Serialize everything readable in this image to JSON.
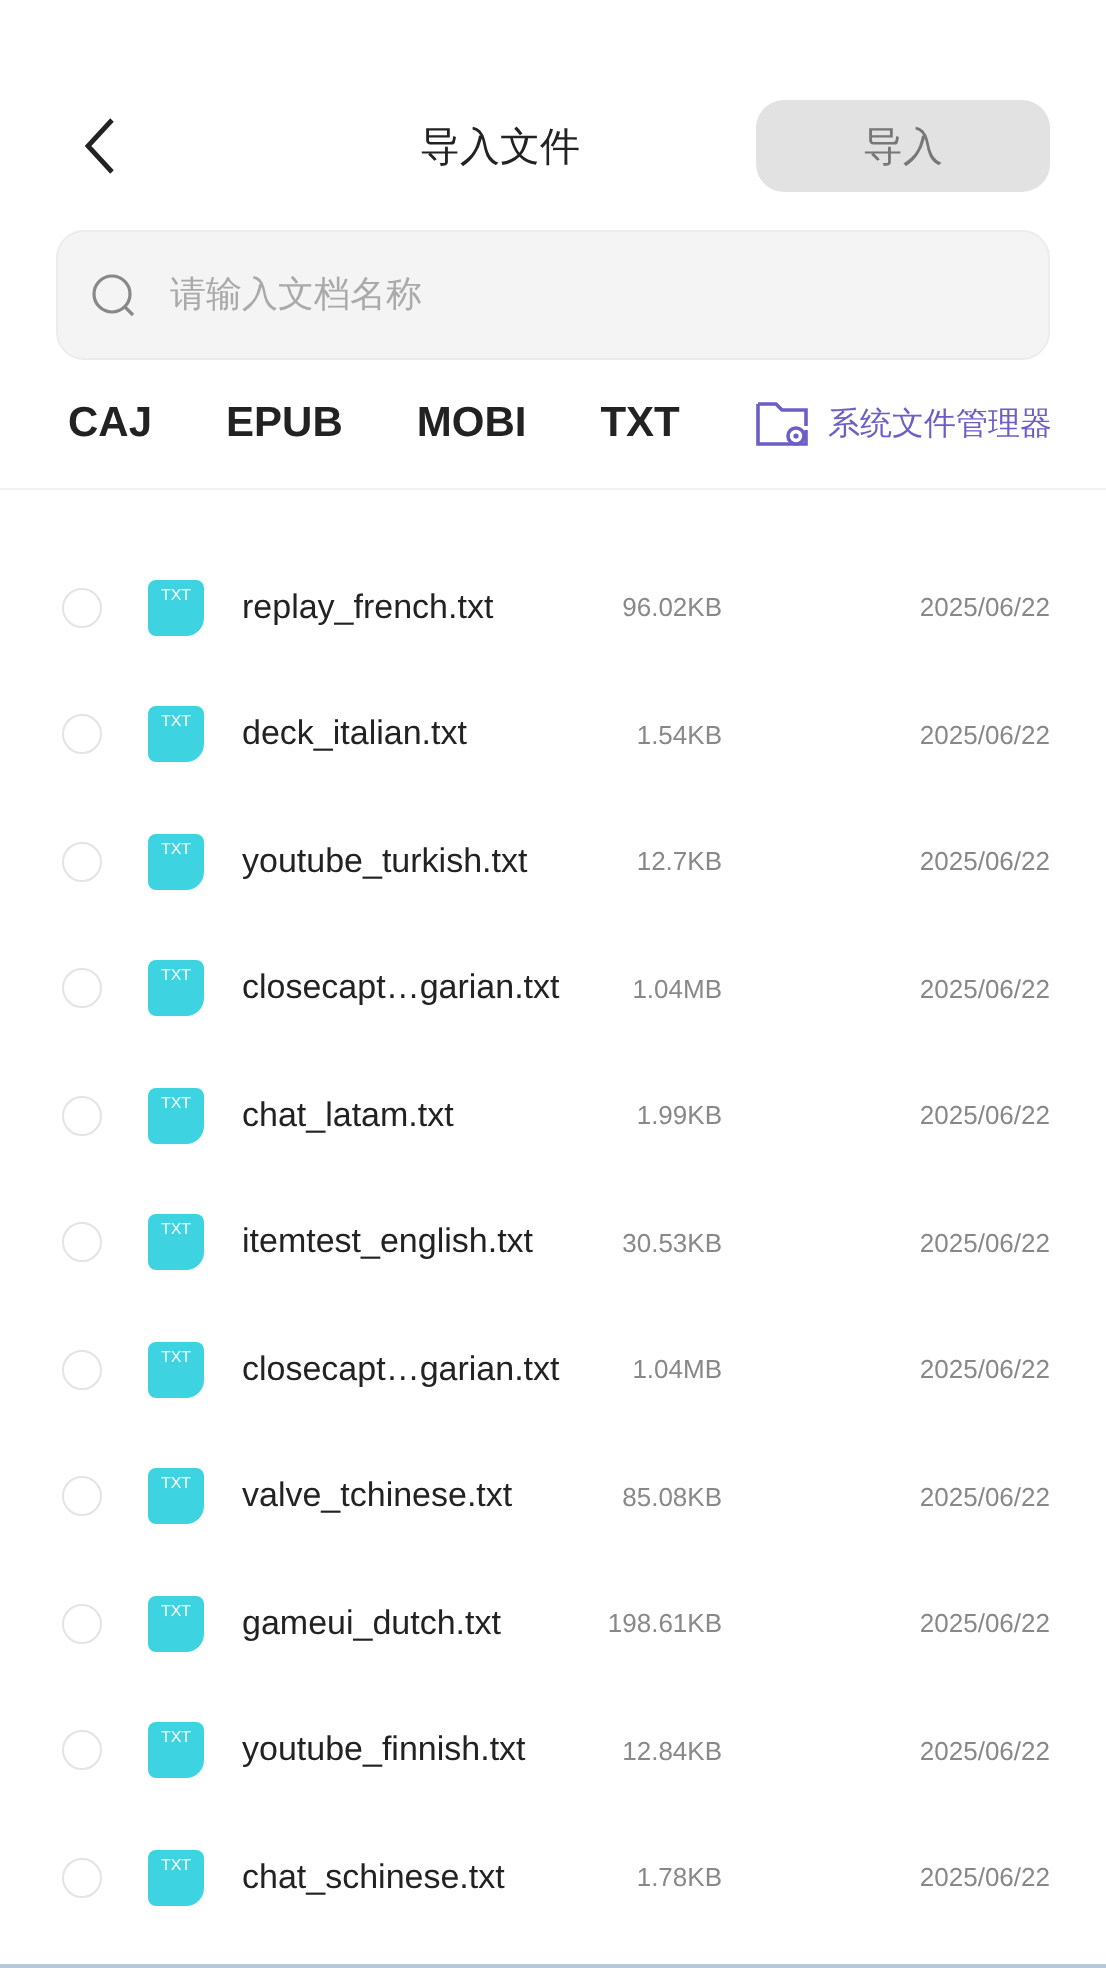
{
  "header": {
    "title": "导入文件",
    "import_button": {
      "label": "导入",
      "disabled": true
    }
  },
  "search": {
    "placeholder": "请输入文档名称"
  },
  "format_tabs": [
    "CAJ",
    "EPUB",
    "MOBI",
    "TXT"
  ],
  "file_manager_link": {
    "label": "系统文件管理器"
  },
  "files": [
    {
      "badge": "TXT",
      "name": "replay_french.txt",
      "size": "96.02KB",
      "date": "2025/06/22",
      "selected": false
    },
    {
      "badge": "TXT",
      "name": "deck_italian.txt",
      "size": "1.54KB",
      "date": "2025/06/22",
      "selected": false
    },
    {
      "badge": "TXT",
      "name": "youtube_turkish.txt",
      "size": "12.7KB",
      "date": "2025/06/22",
      "selected": false
    },
    {
      "badge": "TXT",
      "name": "closecapt…garian.txt",
      "size": "1.04MB",
      "date": "2025/06/22",
      "selected": false
    },
    {
      "badge": "TXT",
      "name": "chat_latam.txt",
      "size": "1.99KB",
      "date": "2025/06/22",
      "selected": false
    },
    {
      "badge": "TXT",
      "name": "itemtest_english.txt",
      "size": "30.53KB",
      "date": "2025/06/22",
      "selected": false
    },
    {
      "badge": "TXT",
      "name": "closecapt…garian.txt",
      "size": "1.04MB",
      "date": "2025/06/22",
      "selected": false
    },
    {
      "badge": "TXT",
      "name": "valve_tchinese.txt",
      "size": "85.08KB",
      "date": "2025/06/22",
      "selected": false
    },
    {
      "badge": "TXT",
      "name": "gameui_dutch.txt",
      "size": "198.61KB",
      "date": "2025/06/22",
      "selected": false
    },
    {
      "badge": "TXT",
      "name": "youtube_finnish.txt",
      "size": "12.84KB",
      "date": "2025/06/22",
      "selected": false
    },
    {
      "badge": "TXT",
      "name": "chat_schinese.txt",
      "size": "1.78KB",
      "date": "2025/06/22",
      "selected": false
    }
  ]
}
